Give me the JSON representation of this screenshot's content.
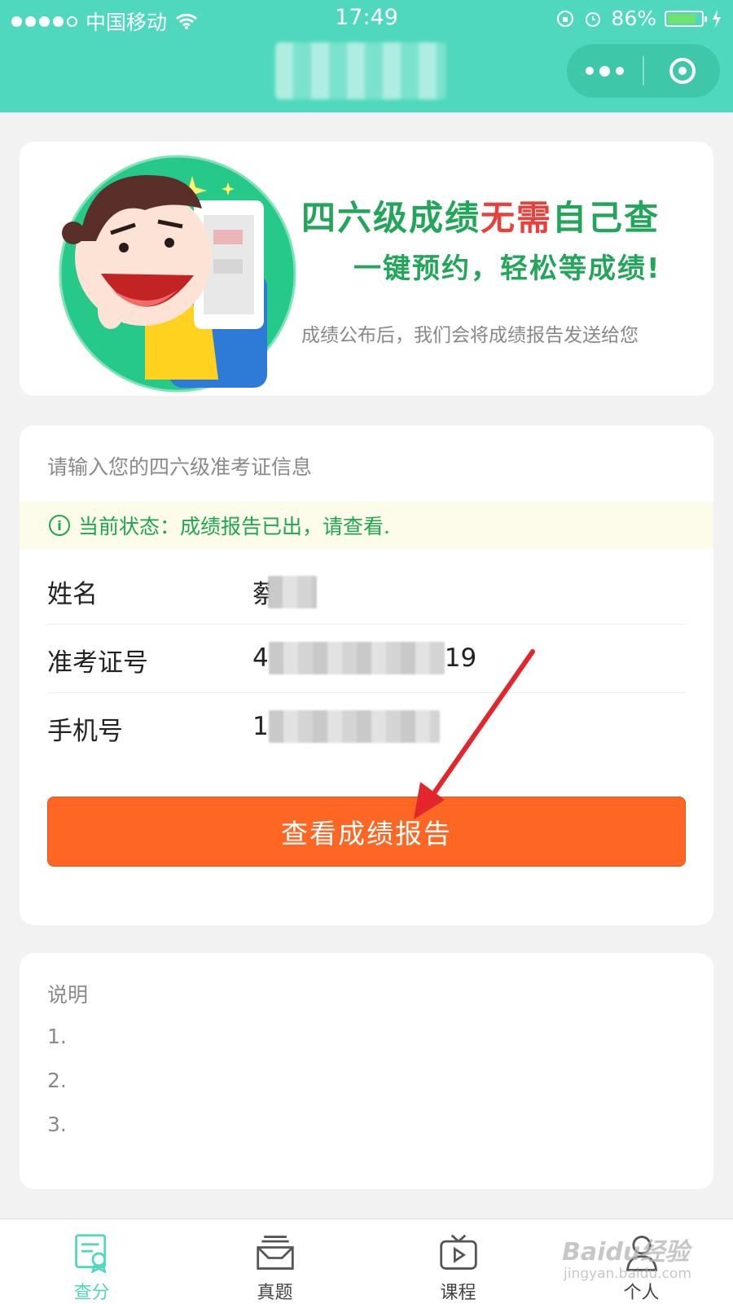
{
  "status_bar": {
    "carrier": "中国移动",
    "time": "17:49",
    "battery": "86%",
    "battery_level": 0.86
  },
  "banner": {
    "title_part1": "四六级成绩",
    "title_red": "无需",
    "title_part2": "自己查",
    "subtitle": "一键预约，轻松等成绩!",
    "description": "成绩公布后，我们会将成绩报告发送给您"
  },
  "form": {
    "hint": "请输入您的四六级准考证信息",
    "status": "当前状态：成绩报告已出，请查看.",
    "fields": [
      {
        "label": "姓名",
        "value_prefix": "蔡",
        "value_suffix": ""
      },
      {
        "label": "准考证号",
        "value_prefix": "4",
        "value_suffix": "19"
      },
      {
        "label": "手机号",
        "value_prefix": "1",
        "value_suffix": ""
      }
    ],
    "button_label": "查看成绩报告"
  },
  "notes": {
    "title": "说明",
    "items": [
      "1.",
      "2.",
      "3."
    ]
  },
  "tabbar": {
    "tabs": [
      {
        "label": "查分",
        "icon": "score-check-icon",
        "active": true
      },
      {
        "label": "真题",
        "icon": "inbox-tray-icon",
        "active": false
      },
      {
        "label": "课程",
        "icon": "tv-play-icon",
        "active": false
      },
      {
        "label": "个人",
        "icon": "person-icon",
        "active": false
      }
    ]
  },
  "watermark": {
    "brand": "Baidu经验",
    "domain": "jingyan.baidu.com"
  },
  "colors": {
    "header": "#4fd8bd",
    "title_green": "#23a55a",
    "title_red": "#e8403a",
    "status_green": "#1da84f",
    "button_orange": "#fe6623",
    "arrow_red": "#e3262b"
  }
}
